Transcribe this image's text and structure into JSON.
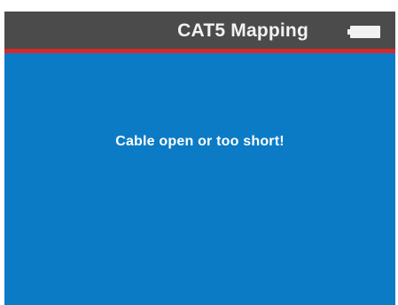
{
  "header": {
    "title": "CAT5 Mapping",
    "battery_icon": "battery-icon",
    "battery_level": 1.0
  },
  "main": {
    "status_message": "Cable open or too short!"
  },
  "colors": {
    "header_background": "#4b4b4b",
    "header_accent": "#d52a2a",
    "screen_background": "#0b7bc6",
    "text": "#ffffff"
  }
}
